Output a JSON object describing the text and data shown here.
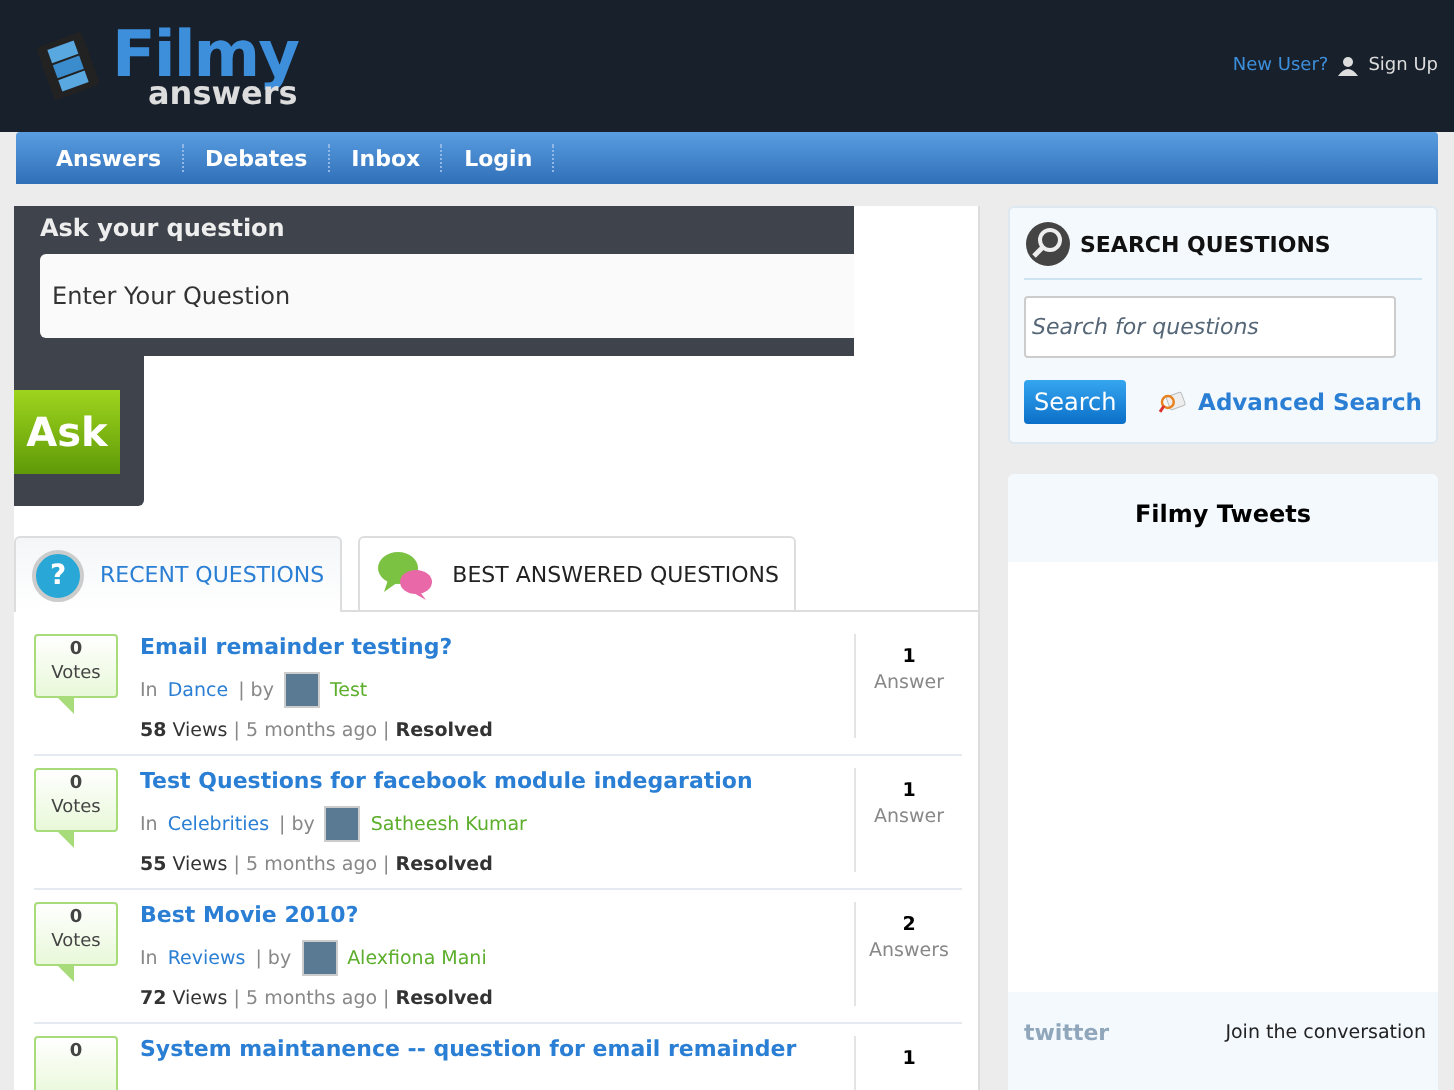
{
  "logo": {
    "title": "Filmy",
    "subtitle": "answers"
  },
  "header_links": {
    "prompt": "New User?",
    "signup": "Sign Up"
  },
  "nav": [
    {
      "label": "Answers"
    },
    {
      "label": "Debates"
    },
    {
      "label": "Inbox"
    },
    {
      "label": "Login"
    }
  ],
  "ask": {
    "title": "Ask your question",
    "placeholder": "Enter Your Question",
    "button": "Ask"
  },
  "tabs": [
    {
      "label": "RECENT QUESTIONS",
      "selected": true,
      "kind": "question",
      "icon": "?"
    },
    {
      "label": "BEST ANSWERED QUESTIONS",
      "selected": false,
      "kind": "chat"
    }
  ],
  "questions": [
    {
      "votes": "0",
      "votes_label": "Votes",
      "title": "Email remainder testing?",
      "in": "In",
      "category": "Dance",
      "by": "| by",
      "author": "Test",
      "views": "58",
      "views_label": "Views",
      "time": "| 5 months ago |",
      "status": "Resolved",
      "answers": "1",
      "answers_label": "Answer"
    },
    {
      "votes": "0",
      "votes_label": "Votes",
      "title": "Test Questions for facebook module indegaration",
      "in": "In",
      "category": "Celebrities",
      "by": "| by",
      "author": "Satheesh Kumar",
      "views": "55",
      "views_label": "Views",
      "time": "| 5 months ago |",
      "status": "Resolved",
      "answers": "1",
      "answers_label": "Answer"
    },
    {
      "votes": "0",
      "votes_label": "Votes",
      "title": "Best Movie 2010?",
      "in": "In",
      "category": "Reviews",
      "by": "| by",
      "author": "Alexfiona Mani",
      "views": "72",
      "views_label": "Views",
      "time": "| 5 months ago |",
      "status": "Resolved",
      "answers": "2",
      "answers_label": "Answers"
    },
    {
      "votes": "0",
      "title": "System maintanence -- question for email remainder",
      "answers": "1"
    }
  ],
  "search": {
    "title": "SEARCH QUESTIONS",
    "placeholder": "Search for questions",
    "button": "Search",
    "advanced": "Advanced Search"
  },
  "tweets": {
    "title": "Filmy Tweets",
    "brand": "twitter",
    "join": "Join the conversation"
  }
}
